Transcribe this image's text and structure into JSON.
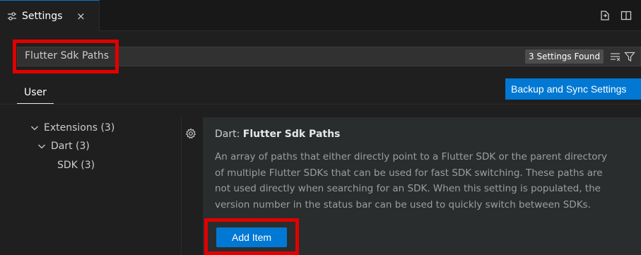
{
  "tab": {
    "title": "Settings",
    "close_glyph": "×",
    "icon": "settings-sliders-icon"
  },
  "actions": {
    "open_json_icon": "open-settings-json-icon",
    "split_icon": "split-editor-icon"
  },
  "search": {
    "value": "Flutter Sdk Paths",
    "results_badge": "3 Settings Found",
    "clear_filter_icon": "clear-filter-icon",
    "filter_icon": "filter-icon"
  },
  "scope": {
    "active_tab": "User",
    "sync_button": "Backup and Sync Settings"
  },
  "toc": {
    "items": [
      {
        "label": "Extensions (3)",
        "expanded": true
      },
      {
        "label": "Dart (3)",
        "expanded": true
      },
      {
        "label": "SDK (3)"
      }
    ]
  },
  "setting": {
    "category": "Dart: ",
    "key": "Flutter Sdk Paths",
    "description_lines": [
      "An array of paths that either directly point to a Flutter SDK or the parent directory",
      "of multiple Flutter SDKs that can be used for fast SDK switching. These paths are",
      "not used directly when searching for an SDK. When this setting is populated, the",
      "version number in the status bar can be used to quickly switch between SDKs."
    ],
    "add_button": "Add Item",
    "gear_icon": "gear-icon"
  },
  "colors": {
    "accent": "#0078d4",
    "highlight": "#e00000",
    "background": "#1f1f1f"
  }
}
